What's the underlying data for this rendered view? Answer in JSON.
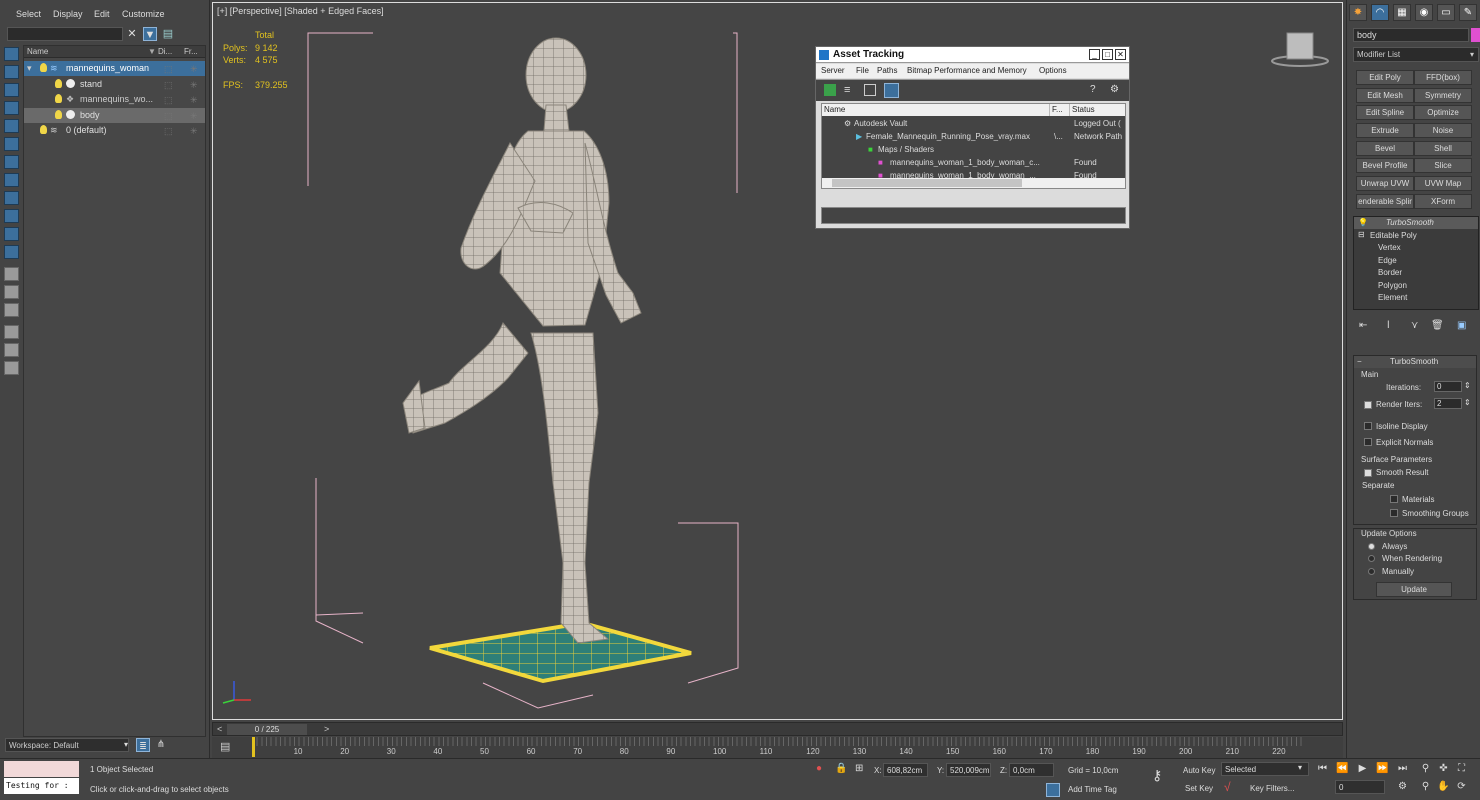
{
  "menu": [
    "Select",
    "Display",
    "Edit",
    "Customize"
  ],
  "explorer": {
    "columns": [
      "Name",
      "Di...",
      "Fr..."
    ],
    "rows": [
      {
        "label": "mannequins_woman"
      },
      {
        "label": "stand"
      },
      {
        "label": "mannequins_wo..."
      },
      {
        "label": "body"
      },
      {
        "label": "0 (default)"
      }
    ]
  },
  "workspace": "Workspace: Default",
  "viewport": {
    "label": "[+] [Perspective] [Shaded + Edged Faces]",
    "stats": {
      "total_label": "Total",
      "polys_label": "Polys:",
      "polys": "9 142",
      "verts_label": "Verts:",
      "verts": "4 575",
      "fps_label": "FPS:",
      "fps": "379.255"
    }
  },
  "asset": {
    "title": "Asset Tracking",
    "menu": [
      "Server",
      "File",
      "Paths",
      "Bitmap Performance and Memory",
      "Options"
    ],
    "columns": [
      "Name",
      "F...",
      "Status"
    ],
    "rows": [
      {
        "name": "Autodesk Vault",
        "f": "",
        "status": "Logged Out ("
      },
      {
        "name": "Female_Mannequin_Running_Pose_vray.max",
        "f": "\\...",
        "status": "Network Path"
      },
      {
        "name": "Maps / Shaders",
        "f": "",
        "status": ""
      },
      {
        "name": "mannequins_woman_1_body_woman_c...",
        "f": "",
        "status": "Found"
      },
      {
        "name": "mannequins_woman_1_body_woman_...",
        "f": "",
        "status": "Found"
      }
    ]
  },
  "command": {
    "object_name": "body",
    "modifier_list": "Modifier List",
    "buttons": [
      "Edit Poly",
      "FFD(box)",
      "Edit Mesh",
      "Symmetry",
      "Edit Spline",
      "Optimize",
      "Extrude",
      "Noise",
      "Bevel",
      "Shell",
      "Bevel Profile",
      "Slice",
      "Unwrap UVW",
      "UVW Map",
      "enderable Splir",
      "XForm"
    ],
    "stack": [
      "TurboSmooth",
      "Editable Poly",
      "Vertex",
      "Edge",
      "Border",
      "Polygon",
      "Element"
    ],
    "turbosmooth": {
      "title": "TurboSmooth",
      "main": "Main",
      "iterations_label": "Iterations:",
      "iterations": "0",
      "render_iters_label": "Render Iters:",
      "render_iters": "2",
      "isoline": "Isoline Display",
      "explicit": "Explicit Normals",
      "surface": "Surface Parameters",
      "smooth_result": "Smooth Result",
      "separate": "Separate",
      "materials": "Materials",
      "smoothing_groups": "Smoothing Groups",
      "update_options": "Update Options",
      "always": "Always",
      "when_rendering": "When Rendering",
      "manually": "Manually",
      "update": "Update"
    }
  },
  "timeline": {
    "frame": "0 / 225",
    "ticks": [
      "10",
      "20",
      "30",
      "40",
      "50",
      "60",
      "70",
      "80",
      "90",
      "100",
      "110",
      "120",
      "130",
      "140",
      "150",
      "160",
      "170",
      "180",
      "190",
      "200",
      "210",
      "220"
    ]
  },
  "status": {
    "script": "Testing for :",
    "selected": "1 Object Selected",
    "prompt": "Click or click-and-drag to select objects",
    "x_label": "X:",
    "x": "608,82cm",
    "y_label": "Y:",
    "y": "520,009cm",
    "z_label": "Z:",
    "z": "0,0cm",
    "grid": "Grid = 10,0cm",
    "add_time_tag": "Add Time Tag",
    "auto_key": "Auto Key",
    "selected_dd": "Selected",
    "set_key": "Set Key",
    "key_filters": "Key Filters...",
    "frame": "0"
  }
}
